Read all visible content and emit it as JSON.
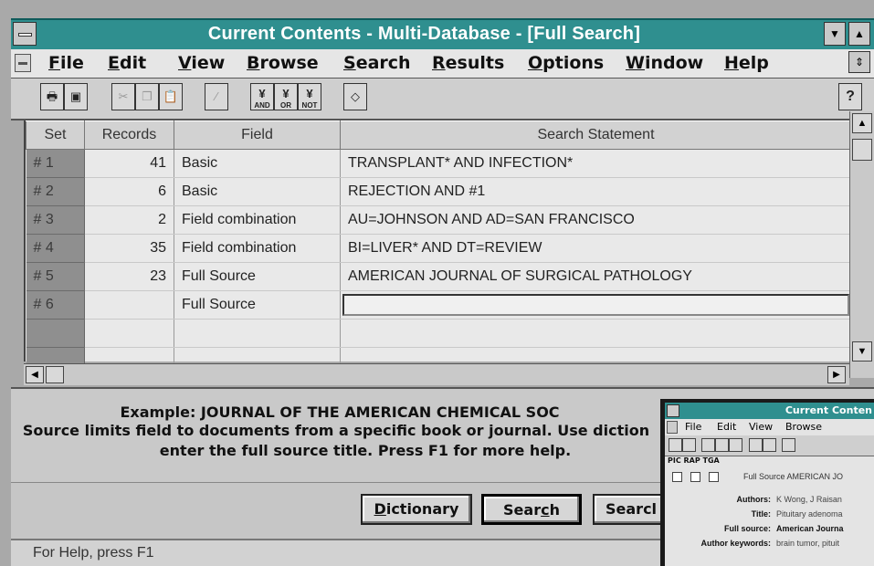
{
  "window": {
    "title": "Current Contents - Multi-Database - [Full Search]",
    "minimize_icon": "down-triangle-icon",
    "maximize_icon": "up-triangle-icon"
  },
  "menu": [
    {
      "label": "File",
      "u": "F",
      "rest": "ile"
    },
    {
      "label": "Edit",
      "u": "E",
      "rest": "dit"
    },
    {
      "label": "View",
      "u": "V",
      "rest": "iew"
    },
    {
      "label": "Browse",
      "u": "B",
      "rest": "rowse"
    },
    {
      "label": "Search",
      "u": "S",
      "rest": "earch"
    },
    {
      "label": "Results",
      "u": "R",
      "rest": "esults"
    },
    {
      "label": "Options",
      "u": "O",
      "rest": "ptions"
    },
    {
      "label": "Window",
      "u": "W",
      "rest": "indow"
    },
    {
      "label": "Help",
      "u": "H",
      "rest": "elp"
    }
  ],
  "toolbar": {
    "and_label": "AND",
    "or_label": "OR",
    "not_label": "NOT",
    "help_glyph": "?"
  },
  "table": {
    "headers": [
      "Set",
      "Records",
      "Field",
      "Search Statement"
    ],
    "rows": [
      {
        "set": "#  1",
        "records": "41",
        "field": "Basic",
        "statement": "TRANSPLANT* AND INFECTION*"
      },
      {
        "set": "#  2",
        "records": "6",
        "field": "Basic",
        "statement": "REJECTION AND #1"
      },
      {
        "set": "#  3",
        "records": "2",
        "field": "Field combination",
        "statement": "AU=JOHNSON AND AD=SAN FRANCISCO"
      },
      {
        "set": "#  4",
        "records": "35",
        "field": "Field combination",
        "statement": "BI=LIVER* AND DT=REVIEW"
      },
      {
        "set": "#  5",
        "records": "23",
        "field": "Full Source",
        "statement": "AMERICAN JOURNAL OF SURGICAL PATHOLOGY"
      },
      {
        "set": "#  6",
        "records": "",
        "field": "Full Source",
        "statement": ""
      }
    ]
  },
  "help": {
    "line1": "Example: JOURNAL OF THE AMERICAN CHEMICAL SOC",
    "line2": "Source limits field to documents from a specific book or journal. Use diction",
    "line3": "enter the full source title. Press F1 for more help."
  },
  "buttons": {
    "dictionary": {
      "u": "D",
      "rest": "ictionary"
    },
    "search": {
      "pre": "Sear",
      "u": "c",
      "rest": "h"
    },
    "search2": "Searcl"
  },
  "status": "For Help, press F1",
  "inset": {
    "title": "Current Conten",
    "menu": [
      "File",
      "Edit",
      "View",
      "Browse"
    ],
    "labels": "PIC  RAP  TGA",
    "row1": "Full Source  AMERICAN JO",
    "fields": [
      {
        "label": "Authors:",
        "value": "K Wong, J Raisan"
      },
      {
        "label": "Title:",
        "value": "Pituitary adenoma"
      },
      {
        "label": "Full source:",
        "value": "American Journa"
      },
      {
        "label": "Author keywords:",
        "value": "brain tumor, pituit"
      }
    ]
  }
}
